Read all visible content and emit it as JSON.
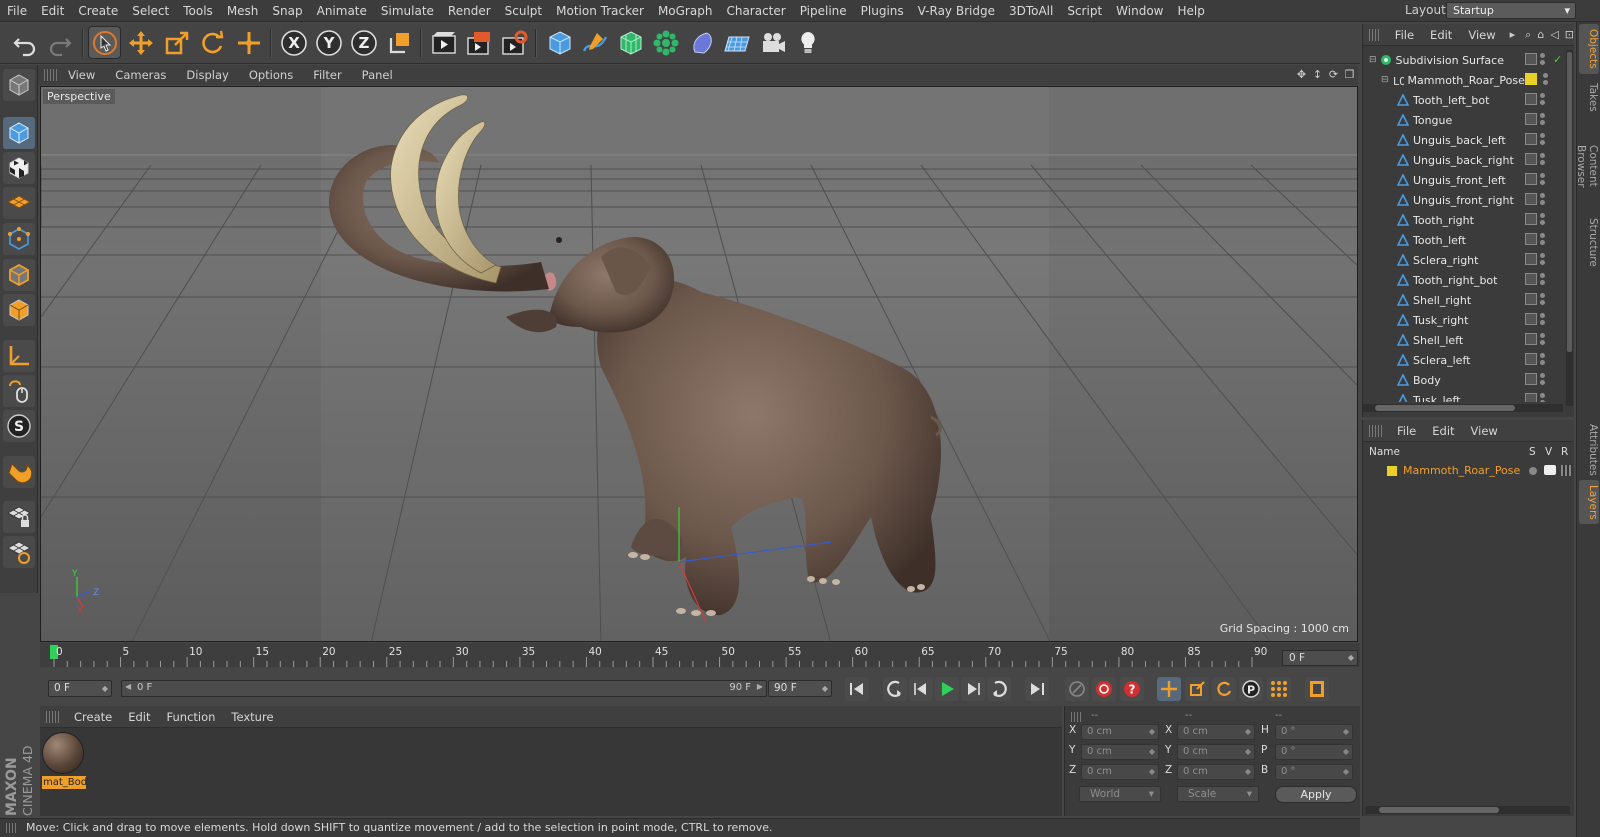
{
  "menubar": {
    "items": [
      "File",
      "Edit",
      "Create",
      "Select",
      "Tools",
      "Mesh",
      "Snap",
      "Animate",
      "Simulate",
      "Render",
      "Sculpt",
      "Motion Tracker",
      "MoGraph",
      "Character",
      "Pipeline",
      "Plugins",
      "V-Ray Bridge",
      "3DToAll",
      "Script",
      "Window",
      "Help"
    ],
    "layout_label": "Layout:",
    "layout_value": "Startup"
  },
  "toolbar": {
    "icons": [
      "undo-icon",
      "redo-icon",
      "live-selection-icon",
      "move-icon",
      "scale-icon",
      "rotate-icon",
      "recent-tool-icon",
      "x-axis-lock-icon",
      "y-axis-lock-icon",
      "z-axis-lock-icon",
      "coordinate-system-icon",
      "render-view-icon",
      "render-picture-viewer-icon",
      "edit-render-settings-icon",
      "cube-primitive-icon",
      "pen-spline-icon",
      "subdivision-surface-icon",
      "cloner-icon",
      "deformer-icon",
      "floor-icon",
      "camera-icon",
      "light-icon"
    ]
  },
  "viewport": {
    "menu": [
      "View",
      "Cameras",
      "Display",
      "Options",
      "Filter",
      "Panel"
    ],
    "label": "Perspective",
    "grid_spacing": "Grid Spacing : 1000 cm",
    "axis_labels": {
      "y": "Y",
      "z": "Z",
      "x": "X"
    }
  },
  "object_manager": {
    "menu": [
      "File",
      "Edit",
      "View"
    ],
    "objects": [
      {
        "name": "Subdivision Surface",
        "level": 0,
        "type": "subdivision"
      },
      {
        "name": "Mammoth_Roar_Pose",
        "level": 1,
        "type": "null"
      },
      {
        "name": "Tooth_left_bot",
        "level": 2,
        "type": "polygon"
      },
      {
        "name": "Tongue",
        "level": 2,
        "type": "polygon"
      },
      {
        "name": "Unguis_back_left",
        "level": 2,
        "type": "polygon"
      },
      {
        "name": "Unguis_back_right",
        "level": 2,
        "type": "polygon"
      },
      {
        "name": "Unguis_front_left",
        "level": 2,
        "type": "polygon"
      },
      {
        "name": "Unguis_front_right",
        "level": 2,
        "type": "polygon"
      },
      {
        "name": "Tooth_right",
        "level": 2,
        "type": "polygon"
      },
      {
        "name": "Tooth_left",
        "level": 2,
        "type": "polygon"
      },
      {
        "name": "Sclera_right",
        "level": 2,
        "type": "polygon"
      },
      {
        "name": "Tooth_right_bot",
        "level": 2,
        "type": "polygon"
      },
      {
        "name": "Shell_right",
        "level": 2,
        "type": "polygon"
      },
      {
        "name": "Tusk_right",
        "level": 2,
        "type": "polygon"
      },
      {
        "name": "Shell_left",
        "level": 2,
        "type": "polygon"
      },
      {
        "name": "Sclera_left",
        "level": 2,
        "type": "polygon"
      },
      {
        "name": "Body",
        "level": 2,
        "type": "polygon"
      },
      {
        "name": "Tusk_left",
        "level": 2,
        "type": "polygon"
      }
    ]
  },
  "right_tabs": [
    "Objects",
    "Takes",
    "Content Browser",
    "Structure",
    "Attributes",
    "Layers"
  ],
  "layer_manager": {
    "menu": [
      "File",
      "Edit",
      "View"
    ],
    "columns": {
      "name": "Name",
      "s": "S",
      "v": "V",
      "r": "R"
    },
    "layers": [
      {
        "name": "Mammoth_Roar_Pose",
        "color": "#e8d024"
      }
    ]
  },
  "timeline": {
    "ticks": [
      "0",
      "5",
      "10",
      "15",
      "20",
      "25",
      "30",
      "35",
      "40",
      "45",
      "50",
      "55",
      "60",
      "65",
      "70",
      "75",
      "80",
      "85",
      "90"
    ],
    "current_frame": "0 F",
    "start_field": "0 F",
    "range_start": "0 F",
    "range_end": "90 F",
    "end_field": "90 F"
  },
  "material_manager": {
    "menu": [
      "Create",
      "Edit",
      "Function",
      "Texture"
    ],
    "materials": [
      {
        "name": "mat_Body"
      }
    ]
  },
  "brand": {
    "line1": "MAXON",
    "line2": "CINEMA 4D"
  },
  "coordinates": {
    "headers": [
      "--",
      "--",
      "--"
    ],
    "rows": [
      {
        "pos_label": "X",
        "pos": "0 cm",
        "size_label": "X",
        "size": "0 cm",
        "rot_label": "H",
        "rot": "0 °"
      },
      {
        "pos_label": "Y",
        "pos": "0 cm",
        "size_label": "Y",
        "size": "0 cm",
        "rot_label": "P",
        "rot": "0 °"
      },
      {
        "pos_label": "Z",
        "pos": "0 cm",
        "size_label": "Z",
        "size": "0 cm",
        "rot_label": "B",
        "rot": "0 °"
      }
    ],
    "space": "World",
    "mode": "Scale",
    "apply": "Apply"
  },
  "statusbar": {
    "text": "Move: Click and drag to move elements. Hold down SHIFT to quantize movement / add to the selection in point mode, CTRL to remove."
  },
  "colors": {
    "accent": "#f0a02a",
    "selection": "#56697d",
    "layer": "#e8d024"
  }
}
